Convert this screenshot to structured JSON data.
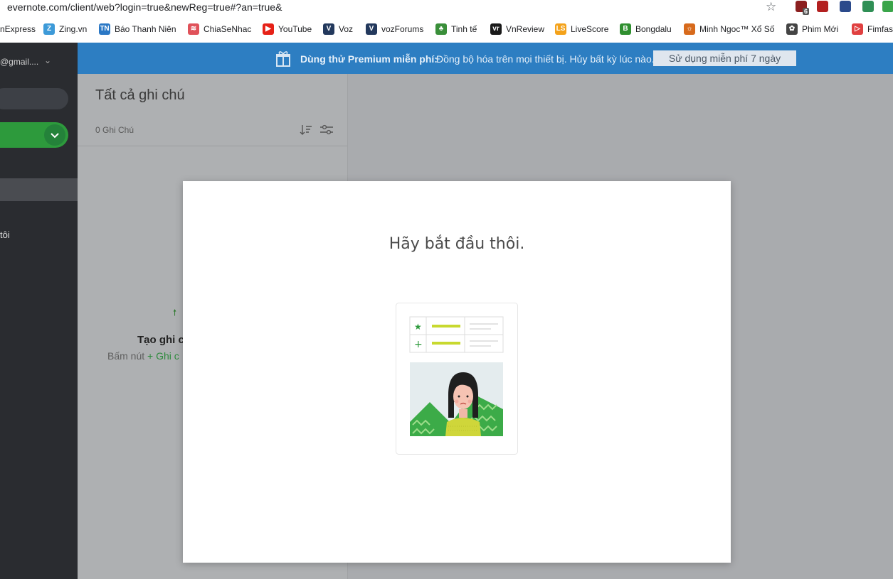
{
  "browser": {
    "url": "evernote.com/client/web?login=true&newReg=true#?an=true&",
    "extensions": [
      {
        "name": "ublock-icon",
        "badge": "6",
        "color": "#8b1f1f"
      },
      {
        "name": "video-ext-icon",
        "color": "#b32020"
      },
      {
        "name": "wordpress-icon",
        "color": "#2b4a8b"
      },
      {
        "name": "s-ext-icon",
        "color": "#2f8f55"
      },
      {
        "name": "shield-check-icon",
        "color": "#3aa54a"
      }
    ],
    "bookmarks": [
      {
        "label": "nExpress",
        "icon": "vnexpress-icon",
        "color": "#ffffff"
      },
      {
        "label": "Zing.vn",
        "icon": "zing-icon",
        "color": "#3d9ad8",
        "glyph": "Z"
      },
      {
        "label": "Báo Thanh Niên",
        "icon": "thanhnien-icon",
        "color": "#2b78c5",
        "glyph": "TN"
      },
      {
        "label": "ChiaSeNhac",
        "icon": "chiasenhac-icon",
        "color": "#e0525a",
        "glyph": "≋"
      },
      {
        "label": "YouTube",
        "icon": "youtube-icon",
        "color": "#e62117",
        "glyph": "▶"
      },
      {
        "label": "Voz",
        "icon": "voz-icon",
        "color": "#23395d",
        "glyph": "V"
      },
      {
        "label": "vozForums",
        "icon": "vozforums-icon",
        "color": "#23395d",
        "glyph": "V"
      },
      {
        "label": "Tinh tế",
        "icon": "tinhte-icon",
        "color": "#3a8f3a",
        "glyph": "♣"
      },
      {
        "label": "VnReview",
        "icon": "vnreview-icon",
        "color": "#1a1a1a",
        "glyph": "vr"
      },
      {
        "label": "LiveScore",
        "icon": "livescore-icon",
        "color": "#f4a21a",
        "glyph": "LS"
      },
      {
        "label": "Bongdalu",
        "icon": "bongdalu-icon",
        "color": "#2f8f2f",
        "glyph": "B"
      },
      {
        "label": "Minh Ngoc™ Xổ Số",
        "icon": "minhngoc-icon",
        "color": "#d76a1c",
        "glyph": "☼"
      },
      {
        "label": "Phim Mới",
        "icon": "phimmoi-icon",
        "color": "#444444",
        "glyph": "✿"
      },
      {
        "label": "Fimfas",
        "icon": "fimfast-icon",
        "color": "#e04040",
        "glyph": "▷"
      }
    ]
  },
  "sidebar": {
    "account": "@gmail....",
    "item_label": "tôi"
  },
  "banner": {
    "bold": "Dùng thử Premium miễn phí:",
    "text": "Đồng bộ hóa trên mọi thiết bị. Hủy bất kỳ lúc nào.",
    "button": "Sử dụng miễn phí 7 ngày"
  },
  "notelist": {
    "title": "Tất cả ghi chú",
    "count": "0 Ghi Chú",
    "empty_title": "Tạo ghi c",
    "empty_sub_prefix": "Bấm nút",
    "empty_sub_green": "+ Ghi c"
  },
  "modal": {
    "title": "Hãy bắt đầu thôi."
  },
  "colors": {
    "sidebar": "#2a2c30",
    "banner": "#2d7ec2",
    "accent_green": "#2d9a3c"
  }
}
